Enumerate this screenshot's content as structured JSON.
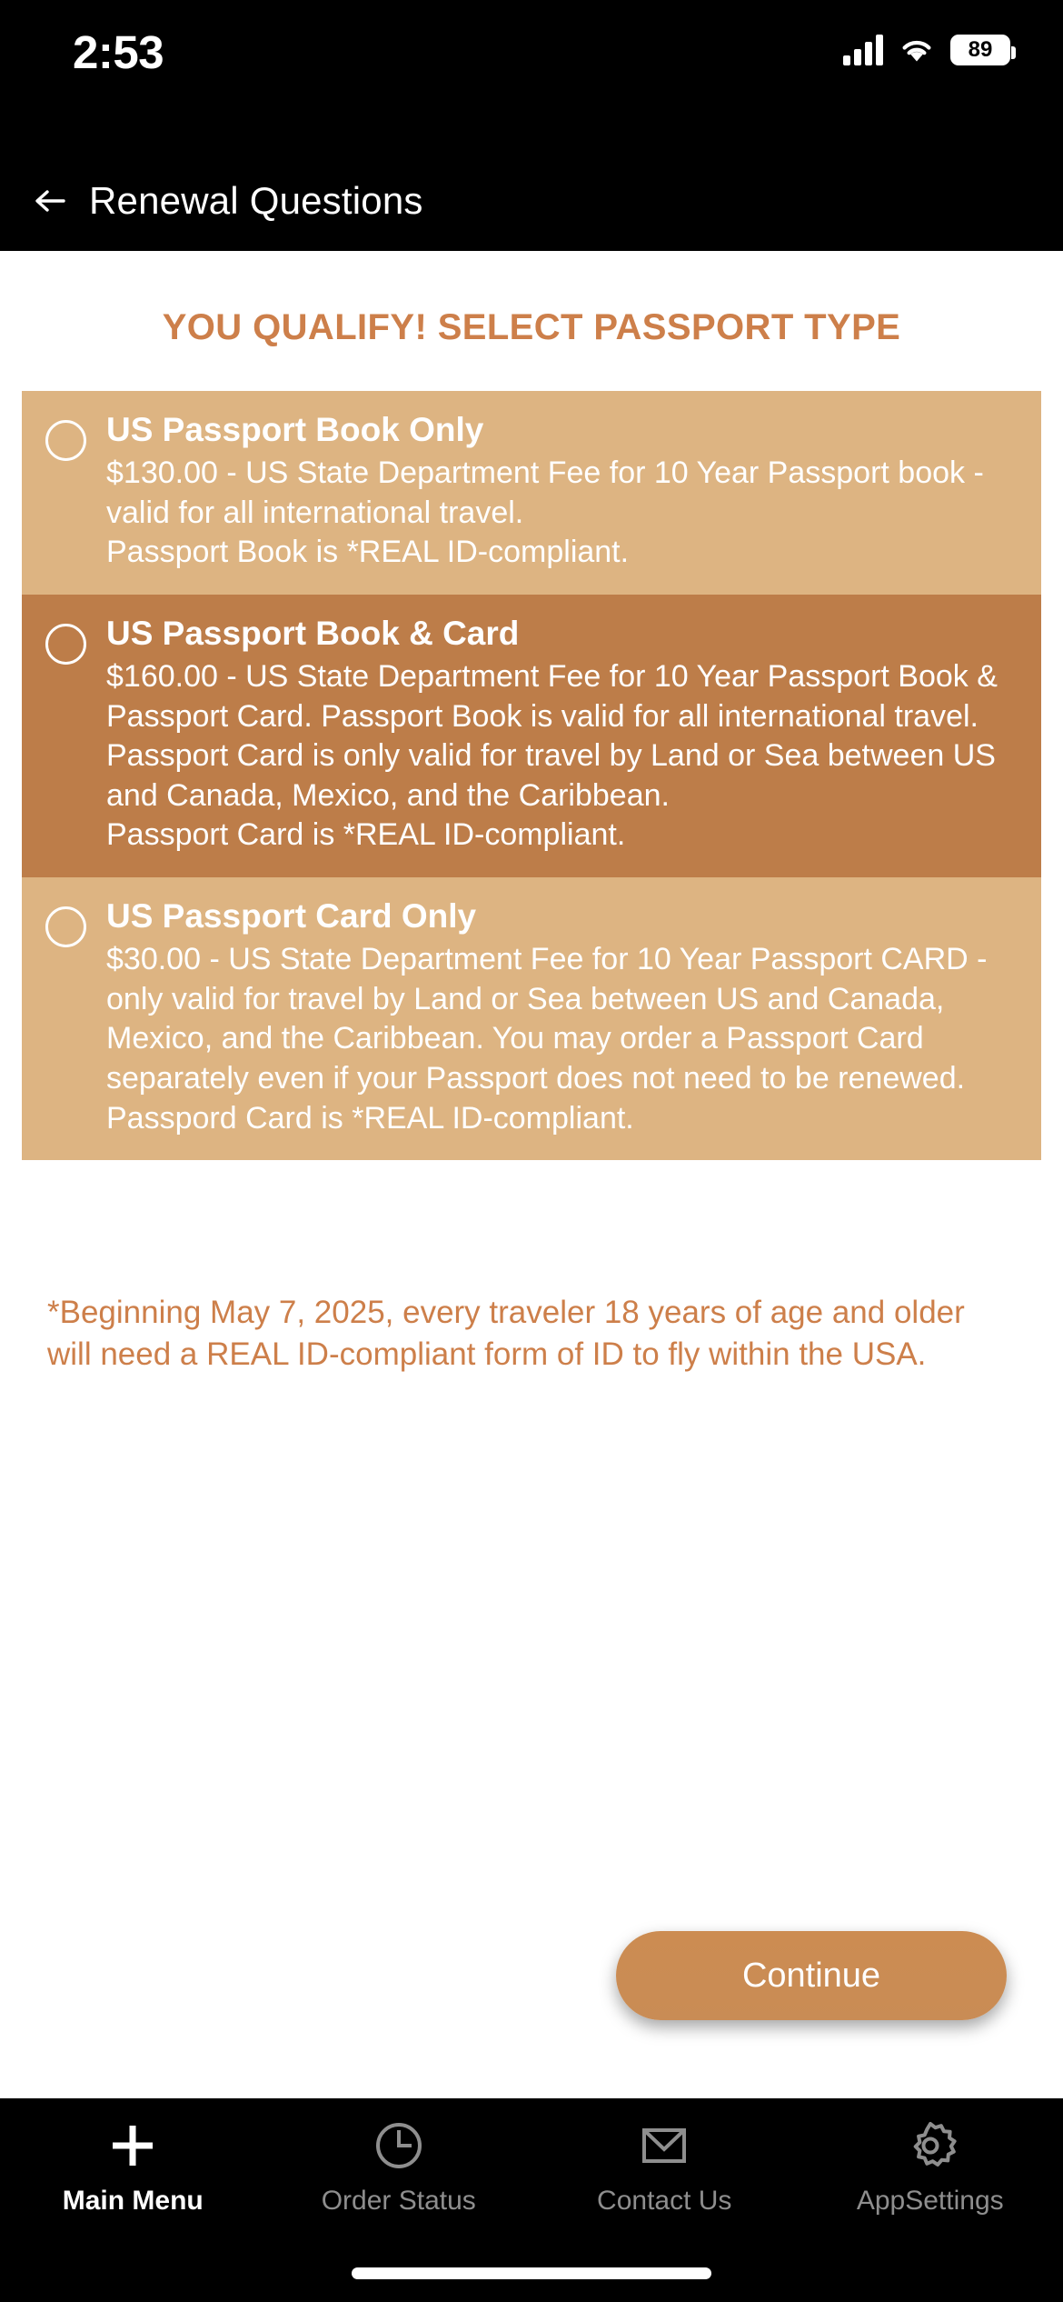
{
  "status_bar": {
    "time": "2:53",
    "battery_percent": "89",
    "cellular_icon": "cellular-signal-icon",
    "wifi_icon": "wifi-icon",
    "battery_icon": "battery-icon"
  },
  "nav": {
    "back_icon": "back-arrow-icon",
    "title": "Renewal Questions"
  },
  "main": {
    "page_title": "YOU QUALIFY! SELECT PASSPORT TYPE",
    "options": [
      {
        "title": "US Passport Book Only",
        "description": "$130.00 - US State Department Fee for 10 Year Passport book - valid for all international travel.\nPassport Book is *REAL ID-compliant.",
        "price": "$130.00",
        "selected": false,
        "background": "#ddb482"
      },
      {
        "title": "US Passport Book & Card",
        "description": "$160.00 - US State Department Fee for 10 Year Passport Book & Passport Card.  Passport Book is valid for all international travel.  Passport Card is only valid for travel by Land or Sea between US and Canada, Mexico, and the Caribbean.\nPassport Card is *REAL ID-compliant.",
        "price": "$160.00",
        "selected": false,
        "background": "#bd7d49"
      },
      {
        "title": "US Passport Card Only",
        "description": "$30.00 - US State Department Fee for 10 Year Passport CARD - only valid for travel by Land or Sea between US and Canada, Mexico, and the Caribbean. You may order a Passport Card separately even if your Passport does not need to be renewed.\nPasspord Card is *REAL ID-compliant.",
        "price": "$30.00",
        "selected": false,
        "background": "#ddb482"
      }
    ],
    "footnote": "*Beginning May 7, 2025, every traveler 18 years of age and older will need a REAL ID-compliant form of ID to fly within the USA.",
    "continue_label": "Continue"
  },
  "tabbar": {
    "items": [
      {
        "label": "Main Menu",
        "icon": "plus-icon",
        "active": true
      },
      {
        "label": "Order Status",
        "icon": "clock-icon",
        "active": false
      },
      {
        "label": "Contact Us",
        "icon": "envelope-icon",
        "active": false
      },
      {
        "label": "AppSettings",
        "icon": "gear-icon",
        "active": false
      }
    ]
  },
  "colors": {
    "accent": "#cd7f4a",
    "card_light": "#ddb482",
    "card_dark": "#bd7d49",
    "button": "#cc8c52",
    "chrome": "#000000"
  }
}
